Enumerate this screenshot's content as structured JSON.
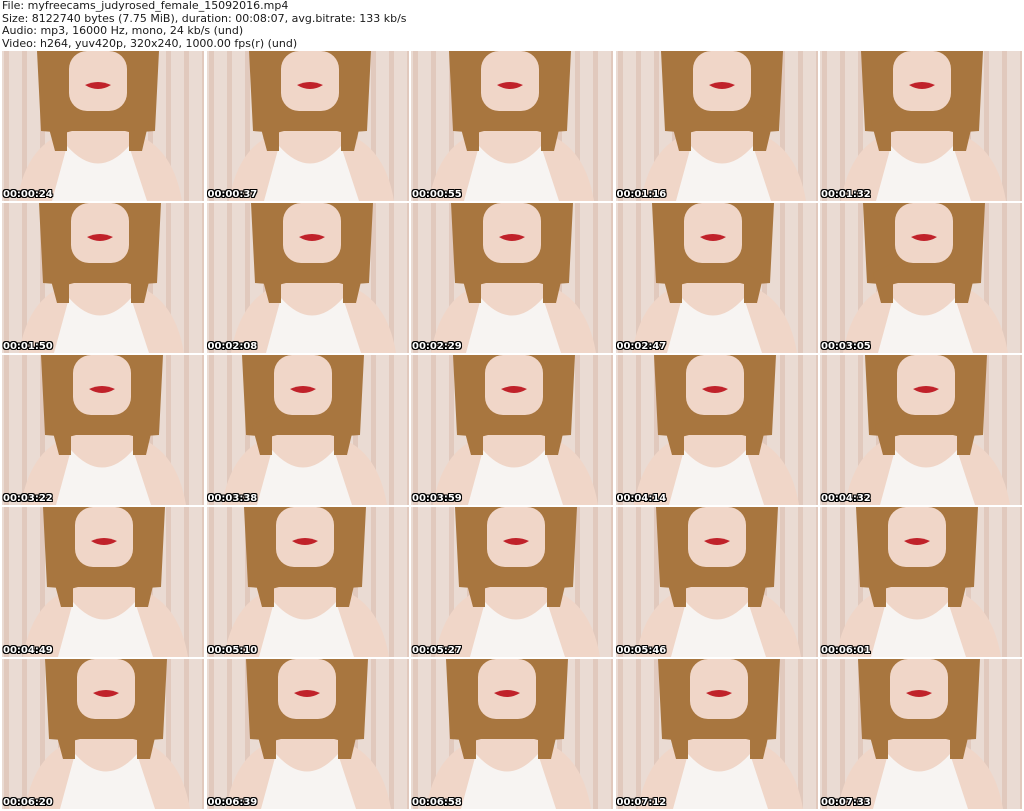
{
  "header": {
    "file_line": "File: myfreecams_judyrosed_female_15092016.mp4",
    "size_line": "Size: 8122740 bytes (7.75 MiB), duration: 00:08:07, avg.bitrate: 133 kb/s",
    "audio_line": "Audio: mp3, 16000 Hz, mono, 24 kb/s (und)",
    "video_line": "Video: h264, yuv420p, 320x240, 1000.00 fps(r) (und)"
  },
  "thumbnails": [
    {
      "timestamp": "00:00:24"
    },
    {
      "timestamp": "00:00:37"
    },
    {
      "timestamp": "00:00:55"
    },
    {
      "timestamp": "00:01:16"
    },
    {
      "timestamp": "00:01:32"
    },
    {
      "timestamp": "00:01:50"
    },
    {
      "timestamp": "00:02:08"
    },
    {
      "timestamp": "00:02:29"
    },
    {
      "timestamp": "00:02:47"
    },
    {
      "timestamp": "00:03:05"
    },
    {
      "timestamp": "00:03:22"
    },
    {
      "timestamp": "00:03:38"
    },
    {
      "timestamp": "00:03:59"
    },
    {
      "timestamp": "00:04:14"
    },
    {
      "timestamp": "00:04:32"
    },
    {
      "timestamp": "00:04:49"
    },
    {
      "timestamp": "00:05:10"
    },
    {
      "timestamp": "00:05:27"
    },
    {
      "timestamp": "00:05:46"
    },
    {
      "timestamp": "00:06:01"
    },
    {
      "timestamp": "00:06:20"
    },
    {
      "timestamp": "00:06:39"
    },
    {
      "timestamp": "00:06:58"
    },
    {
      "timestamp": "00:07:12"
    },
    {
      "timestamp": "00:07:33"
    }
  ],
  "colors": {
    "background_wall": "#eadbd3",
    "wall_stripe": "#d9b9ab",
    "hair": "#a8763f",
    "skin": "#f0d6c8",
    "lips": "#c0222a",
    "top": "#f7f4f2"
  }
}
